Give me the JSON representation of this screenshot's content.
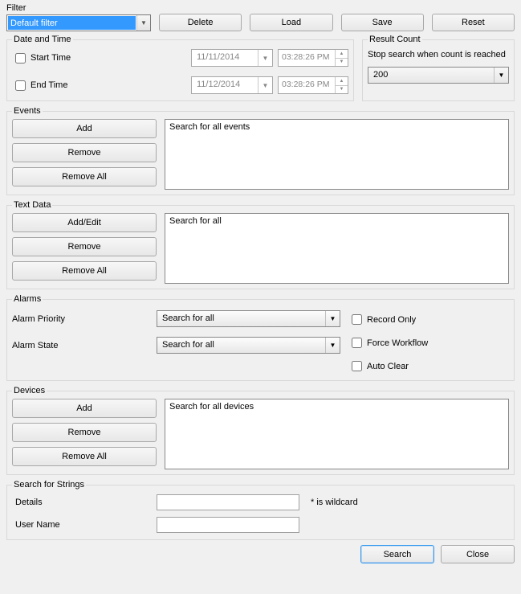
{
  "filter": {
    "label": "Filter",
    "selected": "Default filter",
    "buttons": {
      "delete": "Delete",
      "load": "Load",
      "save": "Save",
      "reset": "Reset"
    }
  },
  "datetime": {
    "legend": "Date and Time",
    "start_label": "Start Time",
    "end_label": "End Time",
    "start_date": "11/11/2014",
    "start_time": "03:28:26 PM",
    "end_date": "11/12/2014",
    "end_time": "03:28:26 PM"
  },
  "result_count": {
    "legend": "Result Count",
    "text": "Stop search when count is reached",
    "value": "200"
  },
  "events": {
    "legend": "Events",
    "add": "Add",
    "remove": "Remove",
    "remove_all": "Remove All",
    "list_text": "Search for all events"
  },
  "textdata": {
    "legend": "Text Data",
    "addedit": "Add/Edit",
    "remove": "Remove",
    "remove_all": "Remove All",
    "list_text": "Search for all"
  },
  "alarms": {
    "legend": "Alarms",
    "priority_label": "Alarm Priority",
    "priority_value": "Search for all",
    "state_label": "Alarm State",
    "state_value": "Search for all",
    "record_only": "Record Only",
    "force_workflow": "Force Workflow",
    "auto_clear": "Auto Clear"
  },
  "devices": {
    "legend": "Devices",
    "add": "Add",
    "remove": "Remove",
    "remove_all": "Remove All",
    "list_text": "Search for all devices"
  },
  "strings": {
    "legend": "Search for Strings",
    "details_label": "Details",
    "user_label": "User Name",
    "wildcard_hint": "* is wildcard"
  },
  "footer": {
    "search": "Search",
    "close": "Close"
  }
}
